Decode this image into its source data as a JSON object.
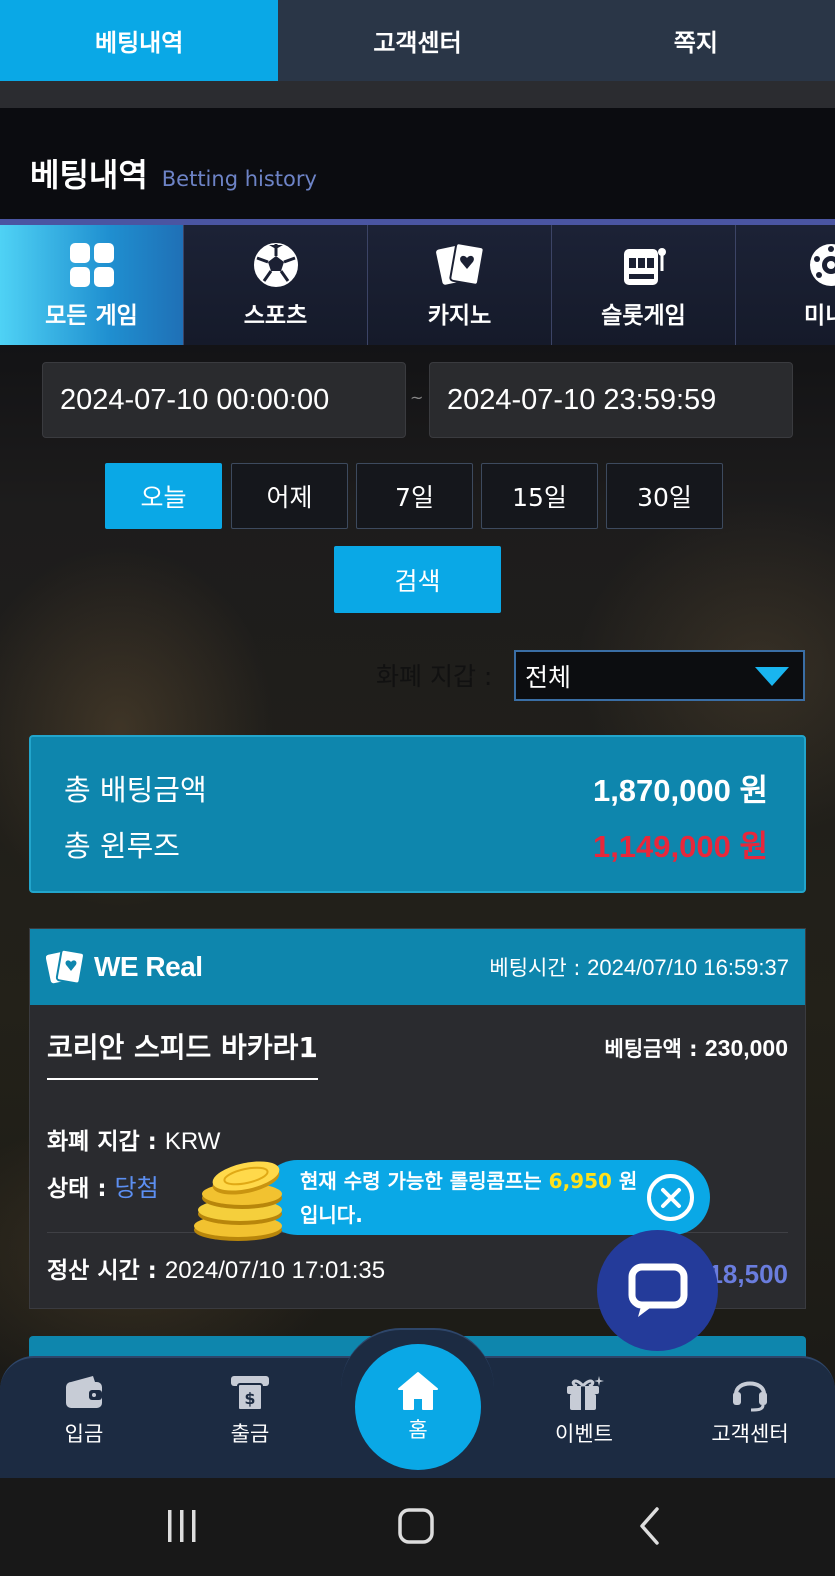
{
  "top_tabs": [
    {
      "label": "베팅내역",
      "active": true
    },
    {
      "label": "고객센터",
      "active": false
    },
    {
      "label": "쪽지",
      "active": false
    }
  ],
  "section": {
    "title": "베팅내역",
    "subtitle": "Betting history"
  },
  "categories": [
    {
      "label": "모든 게임",
      "icon": "grid-icon",
      "active": true
    },
    {
      "label": "스포츠",
      "icon": "soccer-ball-icon",
      "active": false
    },
    {
      "label": "카지노",
      "icon": "playing-cards-icon",
      "active": false
    },
    {
      "label": "슬롯게임",
      "icon": "slot-machine-icon",
      "active": false
    },
    {
      "label": "미니",
      "icon": "roulette-icon",
      "active": false
    }
  ],
  "date_range": {
    "start": "2024-07-10 00:00:00",
    "separator": "~",
    "end": "2024-07-10 23:59:59"
  },
  "periods": [
    {
      "label": "오늘",
      "active": true
    },
    {
      "label": "어제",
      "active": false
    },
    {
      "label": "7일",
      "active": false
    },
    {
      "label": "15일",
      "active": false
    },
    {
      "label": "30일",
      "active": false
    }
  ],
  "search_label": "검색",
  "wallet_filter": {
    "label": "화폐 지갑 :",
    "value": "전체"
  },
  "summary": {
    "total_bet_label": "총 배팅금액",
    "total_bet_value": "1,870,000 원",
    "total_winloss_label": "총 윈루즈",
    "total_winloss_value": "1,149,000 원"
  },
  "bet": {
    "provider": "WE Real",
    "bet_time_label": "베팅시간 :",
    "bet_time": "2024/07/10 16:59:37",
    "game_name": "코리안 스피드 바카라1",
    "bet_amount_label": "베팅금액 :",
    "bet_amount": "230,000",
    "wallet_label": "화폐 지갑 :",
    "wallet": "KRW",
    "status_label": "상태 :",
    "status": "당첨",
    "settle_label": "정산 시간 :",
    "settle_time": "2024/07/10 17:01:35",
    "payout_partial": "18,500"
  },
  "toast": {
    "text_before": "현재 수령 가능한 롤링콤프는",
    "amount": "6,950",
    "unit": "원",
    "text_after": "입니다."
  },
  "bottom_nav": {
    "deposit": "입금",
    "withdraw": "출금",
    "home": "홈",
    "event": "이벤트",
    "support": "고객센터"
  },
  "colors": {
    "accent": "#0aa8e6",
    "card_header": "#0e86ad",
    "winloss": "#e8273b",
    "status_win": "#5c8ff2",
    "toast_amount": "#ffe11a"
  }
}
